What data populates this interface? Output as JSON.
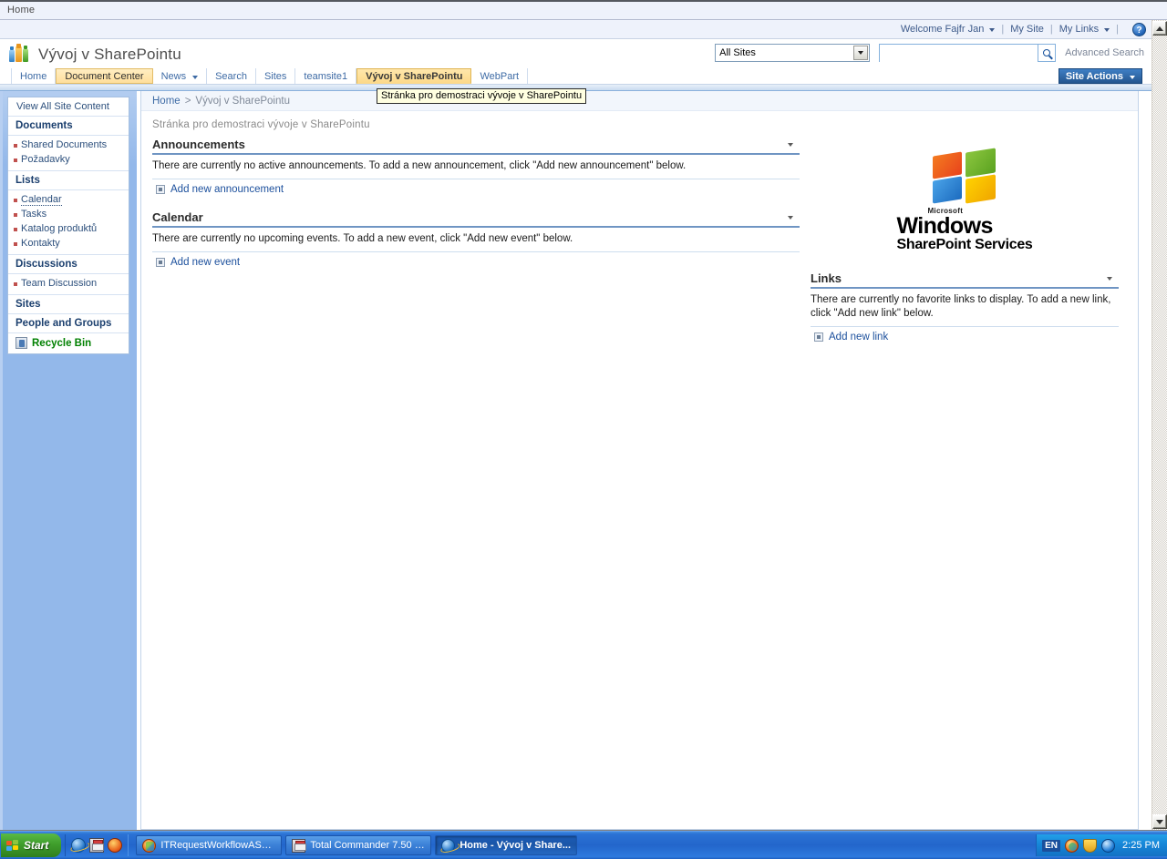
{
  "browser": {
    "window_title": "Home"
  },
  "global_nav": {
    "welcome": "Welcome Fajfr Jan",
    "my_site": "My Site",
    "my_links": "My Links",
    "help_icon": "help-icon",
    "separator": "|"
  },
  "header": {
    "site_title": "Vývoj v SharePointu",
    "logo_icon": "sharepoint-site-logo"
  },
  "search": {
    "scope_value": "All Sites",
    "query_value": "",
    "query_placeholder": "",
    "go_icon": "search-icon",
    "advanced_search": "Advanced Search"
  },
  "site_actions": {
    "label": "Site Actions"
  },
  "top_nav": {
    "tabs": [
      {
        "label": "Home",
        "state": "normal",
        "has_caret": false
      },
      {
        "label": "Document Center",
        "state": "highlight",
        "has_caret": false
      },
      {
        "label": "News",
        "state": "normal",
        "has_caret": true
      },
      {
        "label": "Search",
        "state": "normal",
        "has_caret": false
      },
      {
        "label": "Sites",
        "state": "normal",
        "has_caret": false
      },
      {
        "label": "teamsite1",
        "state": "normal",
        "has_caret": false
      },
      {
        "label": "Vývoj v SharePointu",
        "state": "selected",
        "has_caret": false
      },
      {
        "label": "WebPart",
        "state": "normal",
        "has_caret": false
      }
    ]
  },
  "tooltip": {
    "text": "Stránka pro demostraci vývoje v SharePointu"
  },
  "quick_launch": {
    "view_all": "View All Site Content",
    "groups": [
      {
        "header": "Documents",
        "items": [
          {
            "label": "Shared Documents",
            "dotted": false
          },
          {
            "label": "Požadavky",
            "dotted": false
          }
        ]
      },
      {
        "header": "Lists",
        "items": [
          {
            "label": "Calendar",
            "dotted": true
          },
          {
            "label": "Tasks",
            "dotted": false
          },
          {
            "label": "Katalog produktů",
            "dotted": false
          },
          {
            "label": "Kontakty",
            "dotted": false
          }
        ]
      },
      {
        "header": "Discussions",
        "items": [
          {
            "label": "Team Discussion",
            "dotted": false
          }
        ]
      },
      {
        "header": "Sites",
        "items": []
      },
      {
        "header": "People and Groups",
        "items": []
      }
    ],
    "recycle_bin": "Recycle Bin",
    "recycle_icon": "recycle-bin-icon"
  },
  "breadcrumb": {
    "home": "Home",
    "separator": ">",
    "current": "Vývoj v SharePointu"
  },
  "page": {
    "description": "Stránka pro demostraci vývoje v SharePointu"
  },
  "webparts": {
    "announcements": {
      "title": "Announcements",
      "body": "There are currently no active announcements. To add a new announcement, click \"Add new announcement\" below.",
      "add_link": "Add new announcement",
      "menu_icon": "chevron-down-icon",
      "add_icon": "add-new-item-icon"
    },
    "calendar": {
      "title": "Calendar",
      "body": "There are currently no upcoming events. To add a new event, click \"Add new event\" below.",
      "add_link": "Add new event",
      "menu_icon": "chevron-down-icon",
      "add_icon": "add-new-item-icon"
    },
    "links": {
      "title": "Links",
      "body": "There are currently no favorite links to display. To add a new link, click \"Add new link\" below.",
      "add_link": "Add new link",
      "menu_icon": "chevron-down-icon",
      "add_icon": "add-new-item-icon"
    }
  },
  "wss_logo": {
    "microsoft": "Microsoft",
    "windows": "Windows",
    "product": "SharePoint Services",
    "flag_icon": "windows-flag-icon"
  },
  "taskbar": {
    "start_label": "Start",
    "start_icon": "windows-flag-icon",
    "quick_launch": [
      {
        "icon": "internet-explorer-icon"
      },
      {
        "icon": "save-disk-icon"
      },
      {
        "icon": "firefox-icon"
      }
    ],
    "tasks": [
      {
        "label": "ITRequestWorkflowASP2...",
        "icon": "visual-studio-icon",
        "active": false
      },
      {
        "label": "Total Commander 7.50 - ...",
        "icon": "save-disk-icon",
        "active": false
      },
      {
        "label": "Home - Vývoj v Share...",
        "icon": "internet-explorer-icon",
        "active": true
      }
    ],
    "tray": {
      "language": "EN",
      "icons": [
        {
          "icon": "network-activity-icon"
        },
        {
          "icon": "security-shield-icon"
        },
        {
          "icon": "system-orb-icon"
        }
      ],
      "clock": "2:25 PM"
    }
  },
  "scrollbar": {
    "up_icon": "scroll-up-icon",
    "down_icon": "scroll-down-icon"
  },
  "colors": {
    "accent_blue": "#2366cb",
    "tab_selected": "#fcd989",
    "sidebar_blue": "#93b8ea",
    "link_blue": "#1b4f9c",
    "recycle_green": "#008000"
  }
}
